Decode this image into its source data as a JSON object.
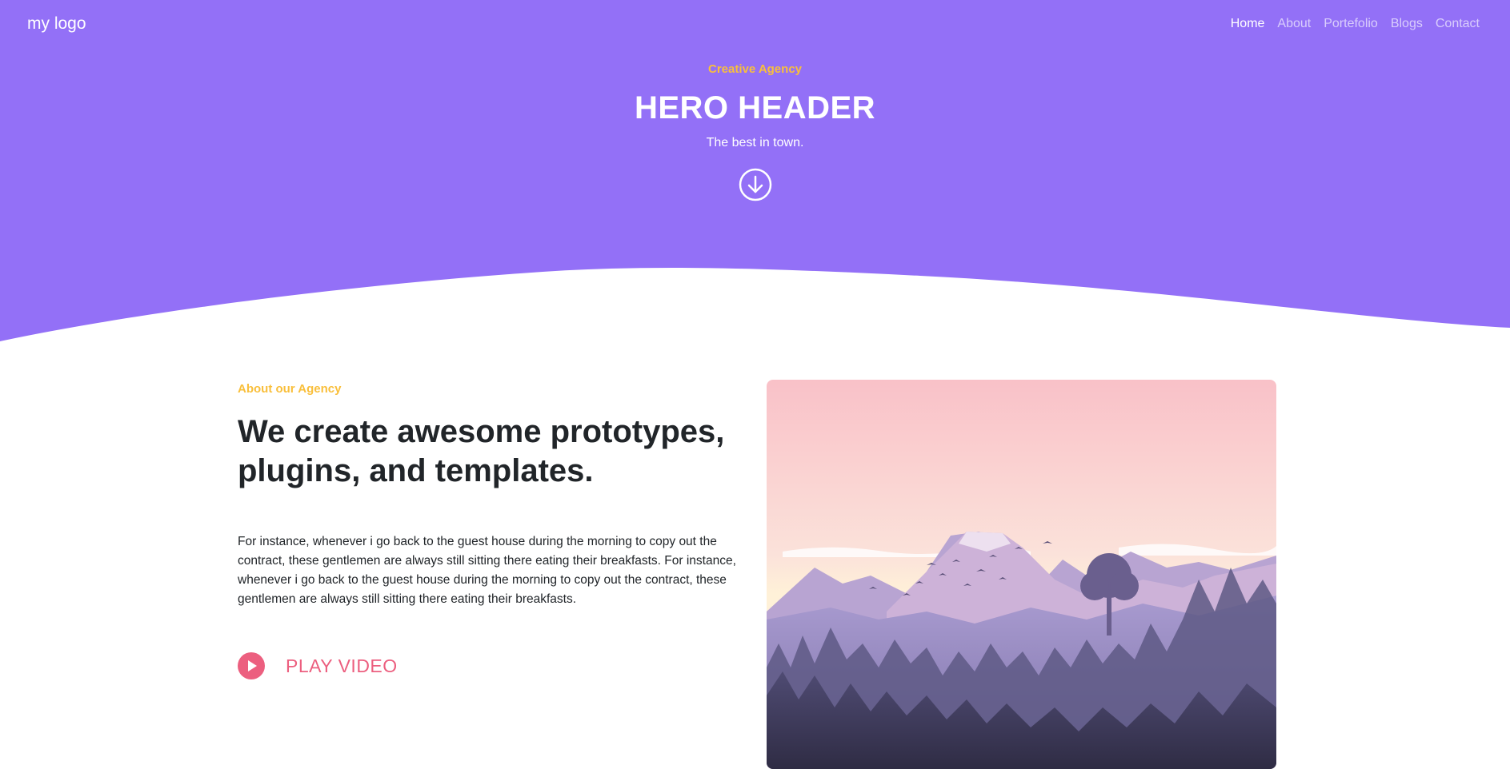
{
  "navbar": {
    "logo": "my logo",
    "items": [
      {
        "label": "Home",
        "active": true
      },
      {
        "label": "About",
        "active": false
      },
      {
        "label": "Portefolio",
        "active": false
      },
      {
        "label": "Blogs",
        "active": false
      },
      {
        "label": "Contact",
        "active": false
      }
    ]
  },
  "hero": {
    "eyebrow": "Creative Agency",
    "title": "HERO HEADER",
    "subtitle": "The best in town.",
    "scroll_icon": "arrow-down-circle-icon"
  },
  "about": {
    "eyebrow": "About our Agency",
    "title": "We create awesome prototypes, plugins, and templates.",
    "body": "For instance, whenever i go back to the guest house during the morning to copy out the contract, these gentlemen are always still sitting there eating their breakfasts. For instance, whenever i go back to the guest house during the morning to copy out the contract, these gentlemen are always still sitting there eating their breakfasts.",
    "play_label": "PLAY VIDEO",
    "play_icon": "play-circle-icon",
    "image": "mountain-landscape-illustration"
  },
  "colors": {
    "hero_bg": "#9370f7",
    "accent_yellow": "#f9bf3b",
    "accent_pink": "#ec5f7f",
    "text_dark": "#212529"
  }
}
